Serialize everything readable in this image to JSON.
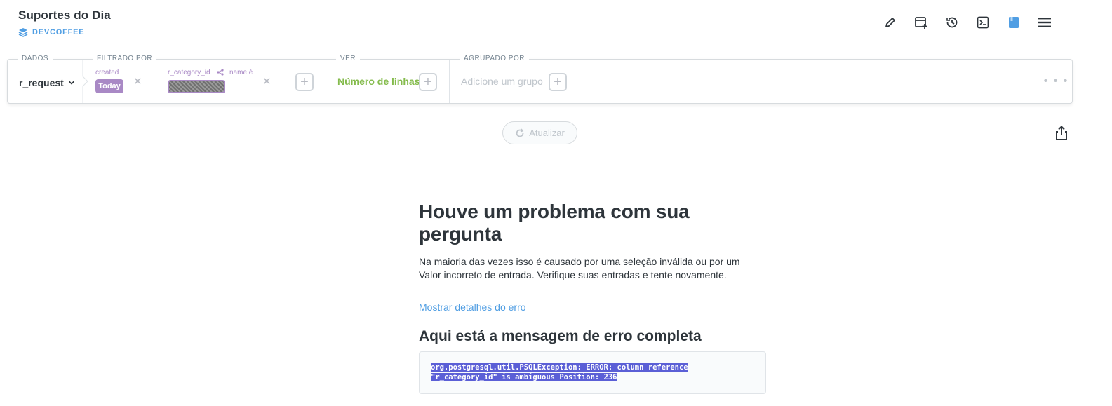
{
  "header": {
    "title": "Suportes do Dia",
    "collection": "DEVCOFFEE",
    "toolbar_icons": [
      "pencil-icon",
      "add-to-dashboard-icon",
      "history-icon",
      "sql-icon",
      "bookmark-icon",
      "menu-icon"
    ],
    "accent": "#509ee3"
  },
  "querybar": {
    "data_label": "DADOS",
    "filter_label": "FILTRADO POR",
    "view_label": "VER",
    "group_label": "AGRUPADO POR",
    "source": "r_request",
    "filters": [
      {
        "field": "created",
        "value": "Today"
      },
      {
        "field": "r_category_id",
        "subfield": "name é",
        "value": ""
      }
    ],
    "view": "Número de linhas",
    "group_placeholder": "Adicione um grupo",
    "more": "• • •"
  },
  "refresh_label": "Atualizar",
  "error": {
    "title": "Houve um problema com sua pergunta",
    "description": "Na maioria das vezes isso é causado por uma seleção inválida ou por um Valor incorreto de entrada. Verifique suas entradas e tente novamente.",
    "details_link": "Mostrar detalhes do erro",
    "full_title": "Aqui está a mensagem de erro completa",
    "message_line1": "org.postgresql.util.PSQLException: ERROR: column reference ",
    "message_line2": "\"r_category_id\" is ambiguous Position: 236"
  }
}
